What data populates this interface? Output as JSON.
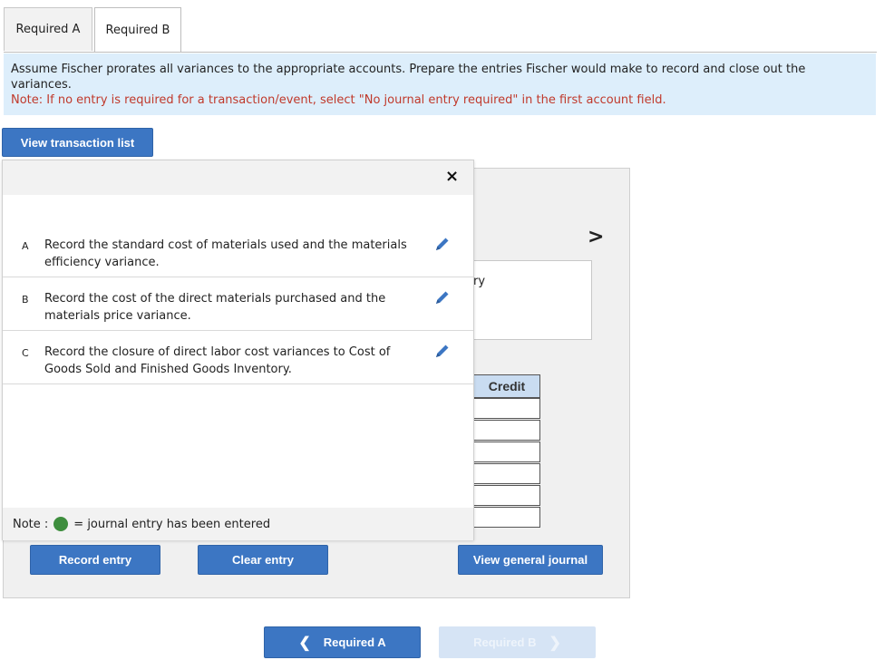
{
  "tabs": [
    {
      "label": "Required A",
      "active": false
    },
    {
      "label": "Required B",
      "active": true
    }
  ],
  "instructions": {
    "text": "Assume Fischer prorates all variances to the appropriate accounts. Prepare the entries Fischer would make to record and close out the variances.",
    "note": "Note: If no entry is required for a transaction/event, select \"No journal entry required\" in the first account field."
  },
  "buttons": {
    "view_transaction_list": "View transaction list",
    "record_entry": "Record entry",
    "clear_entry": "Clear entry",
    "view_general_journal": "View general journal"
  },
  "popup": {
    "close_symbol": "×",
    "transactions": [
      {
        "letter": "A",
        "text": "Record the standard cost of materials used and the materials efficiency variance."
      },
      {
        "letter": "B",
        "text": "Record the cost of the direct materials purchased and the materials price variance."
      },
      {
        "letter": "C",
        "text": "Record the closure of direct labor cost variances to Cost of Goods Sold and Finished Goods Inventory."
      }
    ],
    "note_prefix": "Note :",
    "note_suffix": "= journal entry has been entered"
  },
  "journal": {
    "credit_header": "Credit",
    "hidden_text_fragment": "ry",
    "next_chevron": ">"
  },
  "navigation": {
    "prev_label": "Required A",
    "next_label": "Required B",
    "prev_enabled": true,
    "next_enabled": false
  },
  "colors": {
    "primary_button": "#3c76c3",
    "instruction_bg": "#ddeefb",
    "note_red": "#c0392b",
    "entered_green": "#3e8e3e",
    "credit_header_bg": "#c9dcf1",
    "disabled_button": "#d6e4f5"
  },
  "icons": {
    "edit": "pencil-icon",
    "close": "close-icon",
    "next": "chevron-right-icon",
    "prev": "chevron-left-icon"
  }
}
